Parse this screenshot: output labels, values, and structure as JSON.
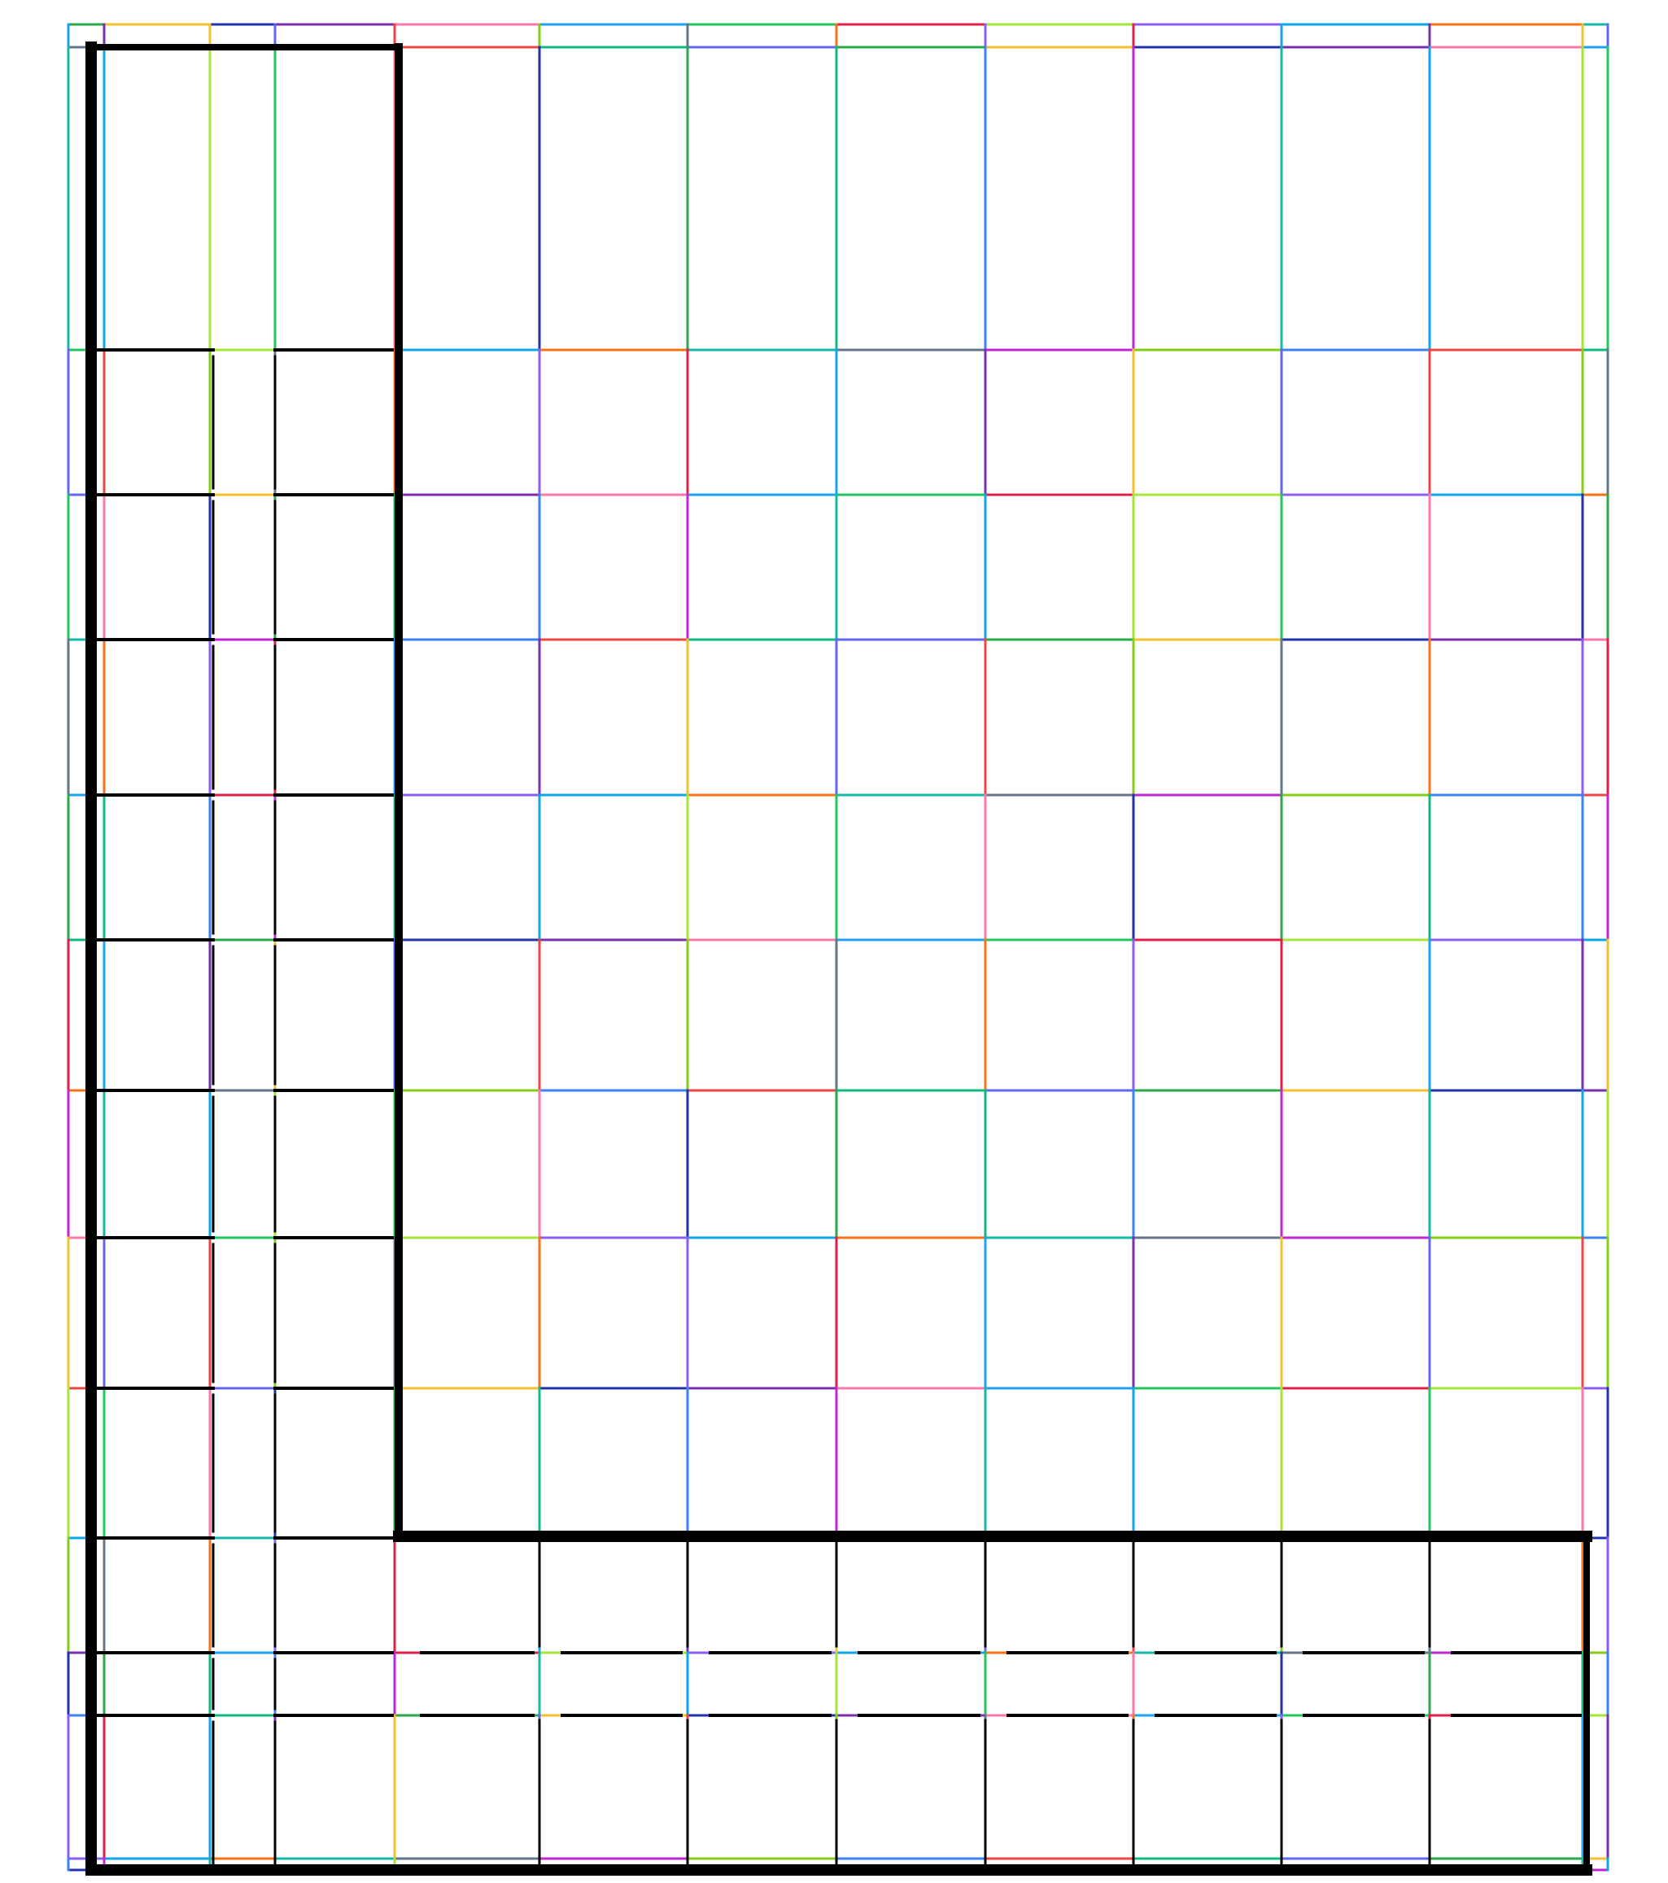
{
  "diagram": {
    "description_visible_text": "",
    "grid": {
      "columns": 12,
      "rows": 12,
      "column_labels": [],
      "row_labels": []
    },
    "colors": {
      "background": "#ffffff",
      "outline": "#000000",
      "grid_palette": [
        "#2aa84a",
        "#f2c12e",
        "#2233aa",
        "#7a2fb0",
        "#ff77aa",
        "#1da1f2",
        "#22c55e",
        "#e11d48",
        "#a3e635",
        "#8b5cf6",
        "#0ea5e9",
        "#f97316",
        "#14b8a6",
        "#64748b",
        "#c026d3",
        "#84cc16",
        "#3b82f6",
        "#ef4444",
        "#10b981",
        "#6366f1"
      ]
    }
  }
}
